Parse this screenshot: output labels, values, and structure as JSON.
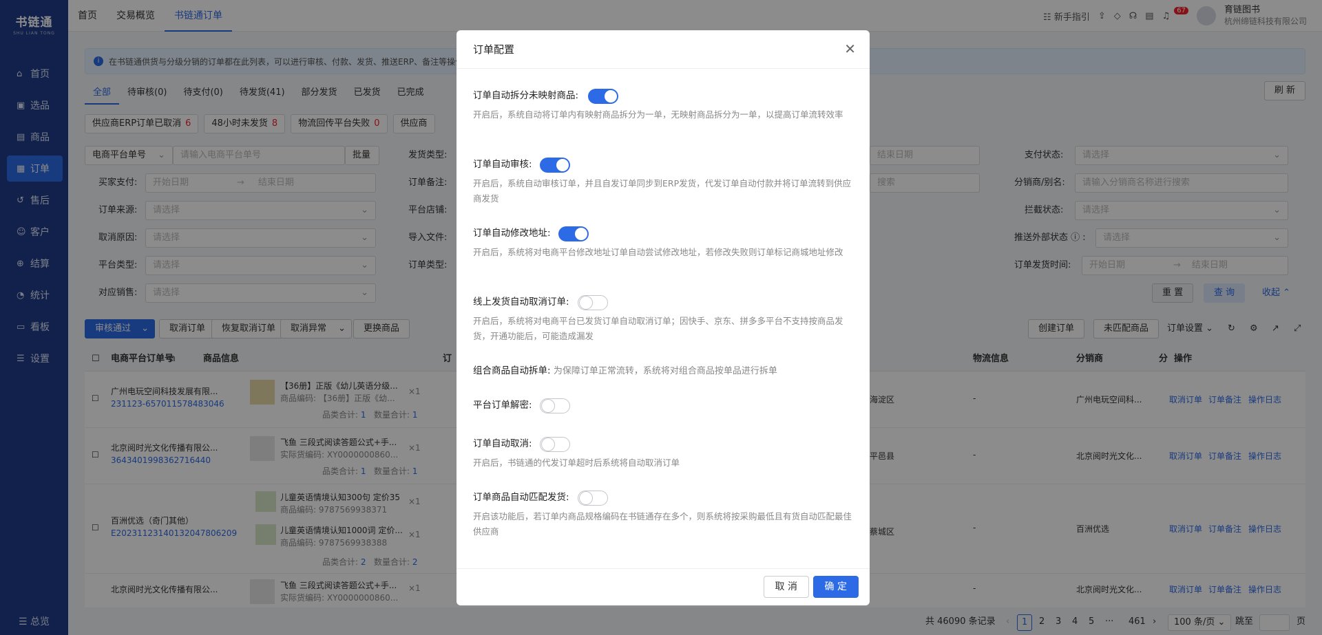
{
  "app": {
    "logo": "书链通",
    "logo_sub": "SHU LIAN TONG"
  },
  "sidebar": {
    "items": [
      {
        "label": "首页",
        "icon": "home-icon"
      },
      {
        "label": "选品",
        "icon": "select-icon"
      },
      {
        "label": "商品",
        "icon": "goods-icon"
      },
      {
        "label": "订单",
        "icon": "order-icon",
        "active": true
      },
      {
        "label": "售后",
        "icon": "after-sale-icon"
      },
      {
        "label": "客户",
        "icon": "customer-icon"
      },
      {
        "label": "结算",
        "icon": "settle-icon"
      },
      {
        "label": "统计",
        "icon": "stats-icon"
      },
      {
        "label": "看板",
        "icon": "board-icon"
      },
      {
        "label": "设置",
        "icon": "settings-icon"
      }
    ],
    "footer": "总览"
  },
  "topbar": {
    "tabs": [
      "首页",
      "交易概览",
      "书链通订单"
    ],
    "guide": "新手指引",
    "badge": "67",
    "user_name": "育链图书",
    "company": "杭州缔链科技有限公司"
  },
  "notice": "在书链通供货与分级分销的订单都在此列表，可以进行审核、付款、发货、推送ERP、备注等操作",
  "status_tabs": [
    "全部",
    "待审核(0)",
    "待支付(0)",
    "待发货(41)",
    "部分发货",
    "已发货",
    "已完成"
  ],
  "refresh": "刷 新",
  "quick_filters": [
    {
      "label": "供应商ERP订单已取消",
      "count": "6"
    },
    {
      "label": "48小时未发货",
      "count": "8"
    },
    {
      "label": "物流回传平台失败",
      "count": "0"
    },
    {
      "label": "供应商",
      "count": ""
    }
  ],
  "filters": {
    "platform_no_select": "电商平台单号",
    "platform_no_placeholder": "请输入电商平台单号",
    "batch": "批量",
    "ship_type": "发货类型:",
    "buyer_pay": "买家支付:",
    "start_date": "开始日期",
    "end_date": "结束日期",
    "order_remark": "订单备注:",
    "order_source": "订单来源:",
    "platform_shop": "平台店铺:",
    "cancel_reason": "取消原因:",
    "import_file": "导入文件:",
    "platform_type": "平台类型:",
    "order_type": "订单类型:",
    "sales": "对应销售:",
    "please_select": "请选择",
    "pay_status": "支付状态:",
    "distributor": "分销商/别名:",
    "distributor_ph": "请输入分销商名称进行搜索",
    "search_ph": "搜索",
    "intercept": "拦截状态:",
    "push_status": "推送外部状态",
    "ship_time": "订单发货时间:",
    "reset": "重 置",
    "query": "查 询",
    "collapse": "收起"
  },
  "actions": {
    "approve": "审核通过",
    "cancel": "取消订单",
    "restore": "恢复取消订单",
    "cancel_abn": "取消异常",
    "replace": "更换商品",
    "create": "创建订单",
    "unmatched": "未匹配商品",
    "settings": "订单设置"
  },
  "table": {
    "headers": [
      "电商平台订单号",
      "商品信息",
      "订",
      "物流信息",
      "分销商",
      "分",
      "操作"
    ],
    "rows": [
      {
        "shop": "广州电玩空间科技发展有限...",
        "no": "231123-657011578483046",
        "goods": "【36册】正版《幼儿英语分级...",
        "code": "商品编码: 【36册】正版《幼...",
        "qty": "×1",
        "cat_label": "品类合计:",
        "cat": "1",
        "num_label": "数量合计:",
        "num": "1",
        "region": "海淀区",
        "logistics": "-",
        "dist": "广州电玩空间科...",
        "ops": [
          "取消订单",
          "订单备注",
          "操作日志"
        ]
      },
      {
        "shop": "北京阅时光文化传播有限公...",
        "no": "3643401998362716440",
        "goods": "飞鱼 三段式阅读答题公式+手...",
        "code": "实际货编码: XY0000000860...",
        "qty": "×1",
        "cat_label": "品类合计:",
        "cat": "1",
        "num_label": "数量合计:",
        "num": "1",
        "region": "平邑县",
        "logistics": "-",
        "dist": "北京阅时光文化...",
        "ops": [
          "取消订单",
          "订单备注",
          "操作日志"
        ]
      },
      {
        "shop": "百洲优选（奇门其他）",
        "no": "E20231123140132047806209",
        "goods": "儿童英语情境认知300句 定价35",
        "code": "商品编码: 9787569938371",
        "goods2": "儿童英语情境认知1000词 定价...",
        "code2": "商品编码: 9787569938388",
        "qty": "×1",
        "cat_label": "品类合计:",
        "cat": "2",
        "num_label": "数量合计:",
        "num": "2",
        "region": "蔡城区",
        "logistics": "-",
        "dist": "百洲优选",
        "ops": [
          "取消订单",
          "订单备注",
          "操作日志"
        ]
      },
      {
        "shop": "北京阅时光文化传播有限公...",
        "no": "",
        "goods": "飞鱼 三段式阅读答题公式+手...",
        "code": "实际货编码: XY0000000860...",
        "qty": "×1",
        "logistics": "-",
        "dist": "北京阅时光文化...",
        "ops": [
          "取消订单",
          "订单备注",
          "操作日志"
        ]
      }
    ]
  },
  "pager": {
    "total": "共 46090 条记录",
    "pages": [
      "1",
      "2",
      "3",
      "4",
      "5",
      "···",
      "461"
    ],
    "size": "100 条/页",
    "jump": "跳至",
    "page_unit": "页"
  },
  "modal": {
    "title": "订单配置",
    "options": [
      {
        "label": "订单自动拆分未映射商品:",
        "on": true,
        "desc": "开启后，系统自动将订单内有映射商品拆分为一单，无映射商品拆分为一单，以提高订单流转效率"
      },
      {
        "label": "订单自动审核:",
        "on": true,
        "desc": "开启后，系统自动审核订单，并且自发订单同步到ERP发货，代发订单自动付款并将订单流转到供应商发货"
      },
      {
        "label": "订单自动修改地址:",
        "on": true,
        "desc": "开启后，系统将对电商平台修改地址订单自动尝试修改地址，若修改失败则订单标记商城地址修改"
      },
      {
        "label": "线上发货自动取消订单:",
        "on": false,
        "desc": "开启后，系统将对电商平台已发货订单自动取消订单；因快手、京东、拼多多平台不支持按商品发货，开通功能后，可能造成漏发"
      },
      {
        "label": "组合商品自动拆单:",
        "hint": "为保障订单正常流转，系统将对组合商品按单品进行拆单"
      },
      {
        "label": "平台订单解密:",
        "on": false,
        "desc": ""
      },
      {
        "label": "订单自动取消:",
        "on": false,
        "desc": "开启后，书链通的代发订单超时后系统将自动取消订单"
      },
      {
        "label": "订单商品自动匹配发货:",
        "on": false,
        "desc": "开启该功能后，若订单内商品规格编码在书链通存在多个，则系统将按采购最低且有货自动匹配最佳供应商"
      }
    ],
    "cancel": "取 消",
    "ok": "确 定"
  },
  "colors": {
    "primary": "#2c6ae6",
    "sidebar": "#1f3c8a",
    "danger": "#f5222d"
  }
}
